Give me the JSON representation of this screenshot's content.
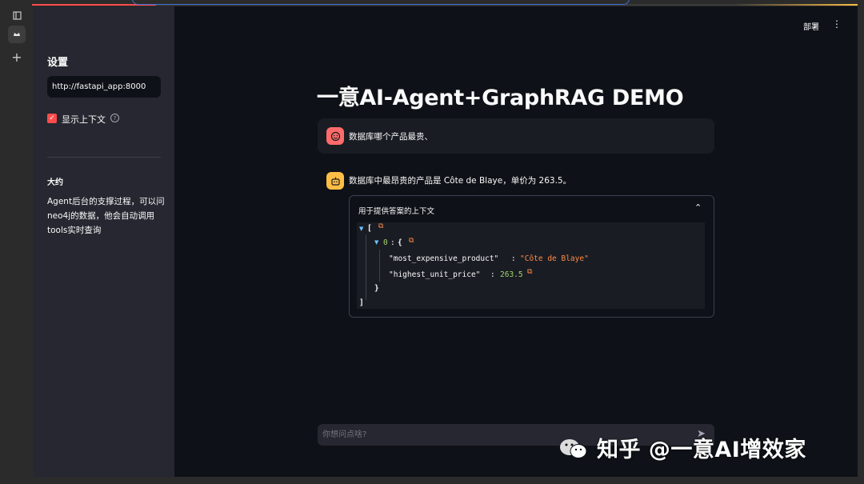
{
  "sidebar": {
    "title": "设置",
    "api_url": "http://fastapi_app:8000",
    "show_context_label": "显示上下文",
    "show_context_checked": true,
    "section_heading": "大约",
    "description": "Agent后台的支撑过程，可以问neo4j的数据，他会自动调用tools实时查询"
  },
  "header": {
    "deploy_label": "部署",
    "menu_icon": "kebab-menu-icon"
  },
  "main": {
    "title": "一意AI-Agent+GraphRAG DEMO",
    "messages": {
      "user": "数据库哪个产品最贵、",
      "assistant": "数据库中最昂贵的产品是 Côte de Blaye，单价为 263.5。"
    },
    "expander": {
      "label": "用于提供答案的上下文",
      "expanded": true
    },
    "json": {
      "open_bracket": "[",
      "index_label": "0",
      "colon": ":",
      "open_brace": "{",
      "key1": "\"most_expensive_product\"",
      "val1": "\"Côte de Blaye\"",
      "key2": "\"highest_unit_price\"",
      "val2": "263.5",
      "close_brace": "}",
      "close_bracket": "]"
    },
    "chat_placeholder": "你想问点啥?"
  },
  "watermark": {
    "text": "知乎 @一意AI增效家"
  },
  "colors": {
    "accent": "#ff4b4b",
    "bot_avatar": "#ffbd45",
    "background": "#0e1117",
    "sidebar": "#262730"
  }
}
